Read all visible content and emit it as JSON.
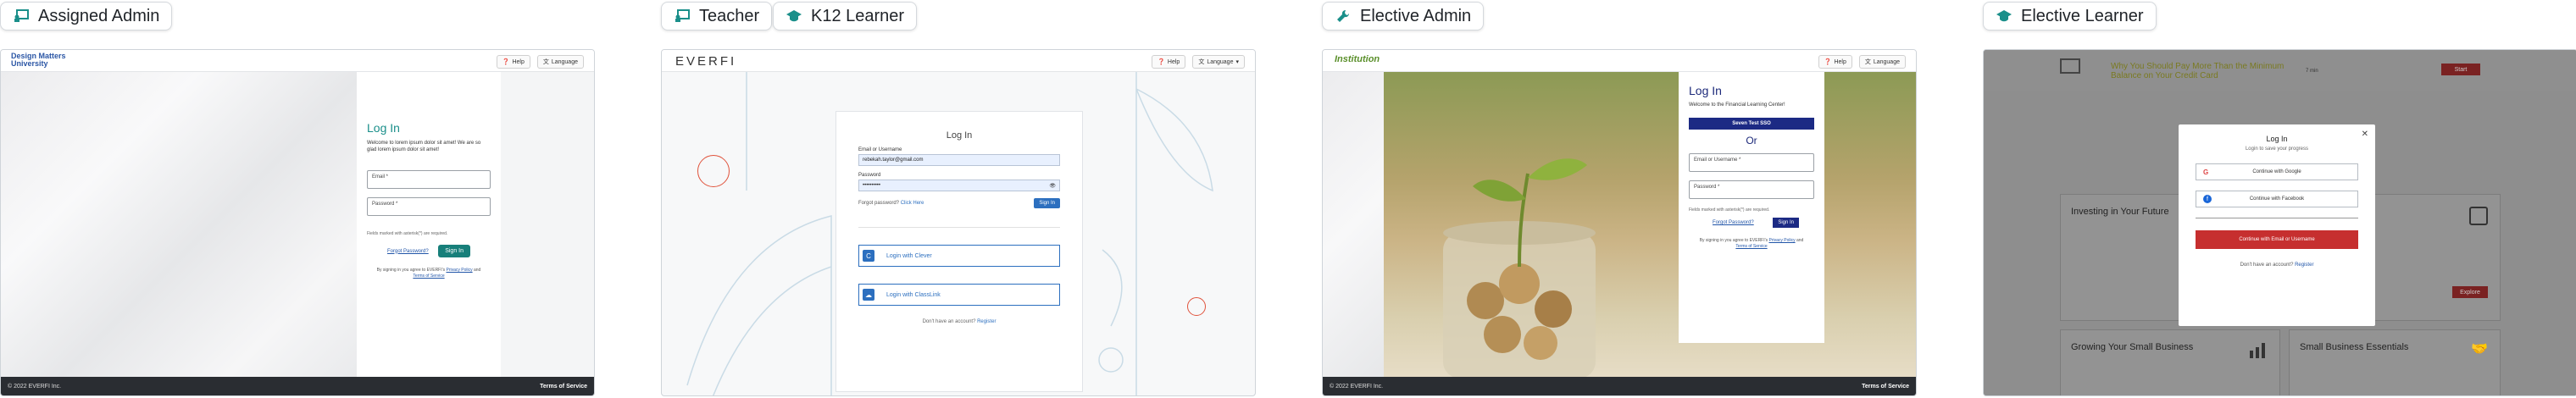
{
  "labels": [
    {
      "text": "Assigned Admin",
      "icon": "chalkboard-teacher-icon"
    },
    {
      "text": "Teacher",
      "icon": "chalkboard-teacher-icon"
    },
    {
      "text": "K12 Learner",
      "icon": "graduation-cap-icon"
    },
    {
      "text": "Elective Admin",
      "icon": "wrench-icon"
    },
    {
      "text": "Elective Learner",
      "icon": "graduation-cap-icon"
    }
  ],
  "colors": {
    "teal": "#177f7a",
    "navy": "#1c2a84",
    "blue": "#2c6fbf",
    "red": "#c62f2f"
  },
  "assigned_admin": {
    "logo": "Design Matters University",
    "help": "Help",
    "language": "Language",
    "title": "Log In",
    "welcome": "Welcome to lorem ipsum dolor sit amet! We are so glad lorem ipsum dolor sit amet!",
    "email_label": "Email *",
    "password_label": "Password *",
    "fields_note": "Fields marked with asterisk(*) are required.",
    "forgot": "Forgot Password?",
    "sign_in": "Sign In",
    "terms_pre": "By signing in you agree to EVERFI's",
    "privacy": "Privacy Policy",
    "and": "and",
    "terms": "Terms of Service",
    "footer_left": "© 2022 EVERFI Inc.",
    "footer_right": "Terms of Service"
  },
  "teacher": {
    "logo": "EVERFI",
    "help": "Help",
    "language": "Language",
    "title": "Log In",
    "email_label": "Email or Username",
    "email_value": "rebekah.taylor@gmail.com",
    "password_label": "Password",
    "password_value": "••••••••••",
    "forgot": "Forgot password?",
    "click_here": "Click Here",
    "sign_in": "Sign In",
    "clever": "Login with Clever",
    "classlink": "Login with ClassLink",
    "no_account": "Don't have an account?",
    "register": "Register"
  },
  "elective_admin": {
    "logo": "Institution",
    "help": "Help",
    "language": "Language",
    "title": "Log In",
    "welcome": "Welcome to the Financial Learning Center!",
    "sso": "Seven Test SSO",
    "or": "Or",
    "email_label": "Email or Username *",
    "password_label": "Password *",
    "fields_note": "Fields marked with asterisk(*) are required.",
    "forgot": "Forgot Password?",
    "sign_in": "Sign In",
    "terms_pre": "By signing in you agree to EVERFI's",
    "privacy": "Privacy Policy",
    "and": "and",
    "terms": "Terms of Service",
    "footer_left": "© 2022 EVERFI Inc.",
    "footer_right": "Terms of Service"
  },
  "elective_learner": {
    "banner_title": "Why You Should Pay More Than the Minimum Balance on Your Credit Card",
    "banner_duration": "7 min",
    "banner_button": "Start",
    "tile1": "Investing in Your Future",
    "tile2": "Growing Your Small Business",
    "tile3": "Small Business Essentials",
    "tile_button": "Explore",
    "modal_title": "Log In",
    "modal_sub": "Login to save your progress",
    "google": "Continue with Google",
    "facebook": "Continue with Facebook",
    "email_btn": "Continue with Email or Username",
    "no_account": "Don't have an account?",
    "register": "Register"
  }
}
